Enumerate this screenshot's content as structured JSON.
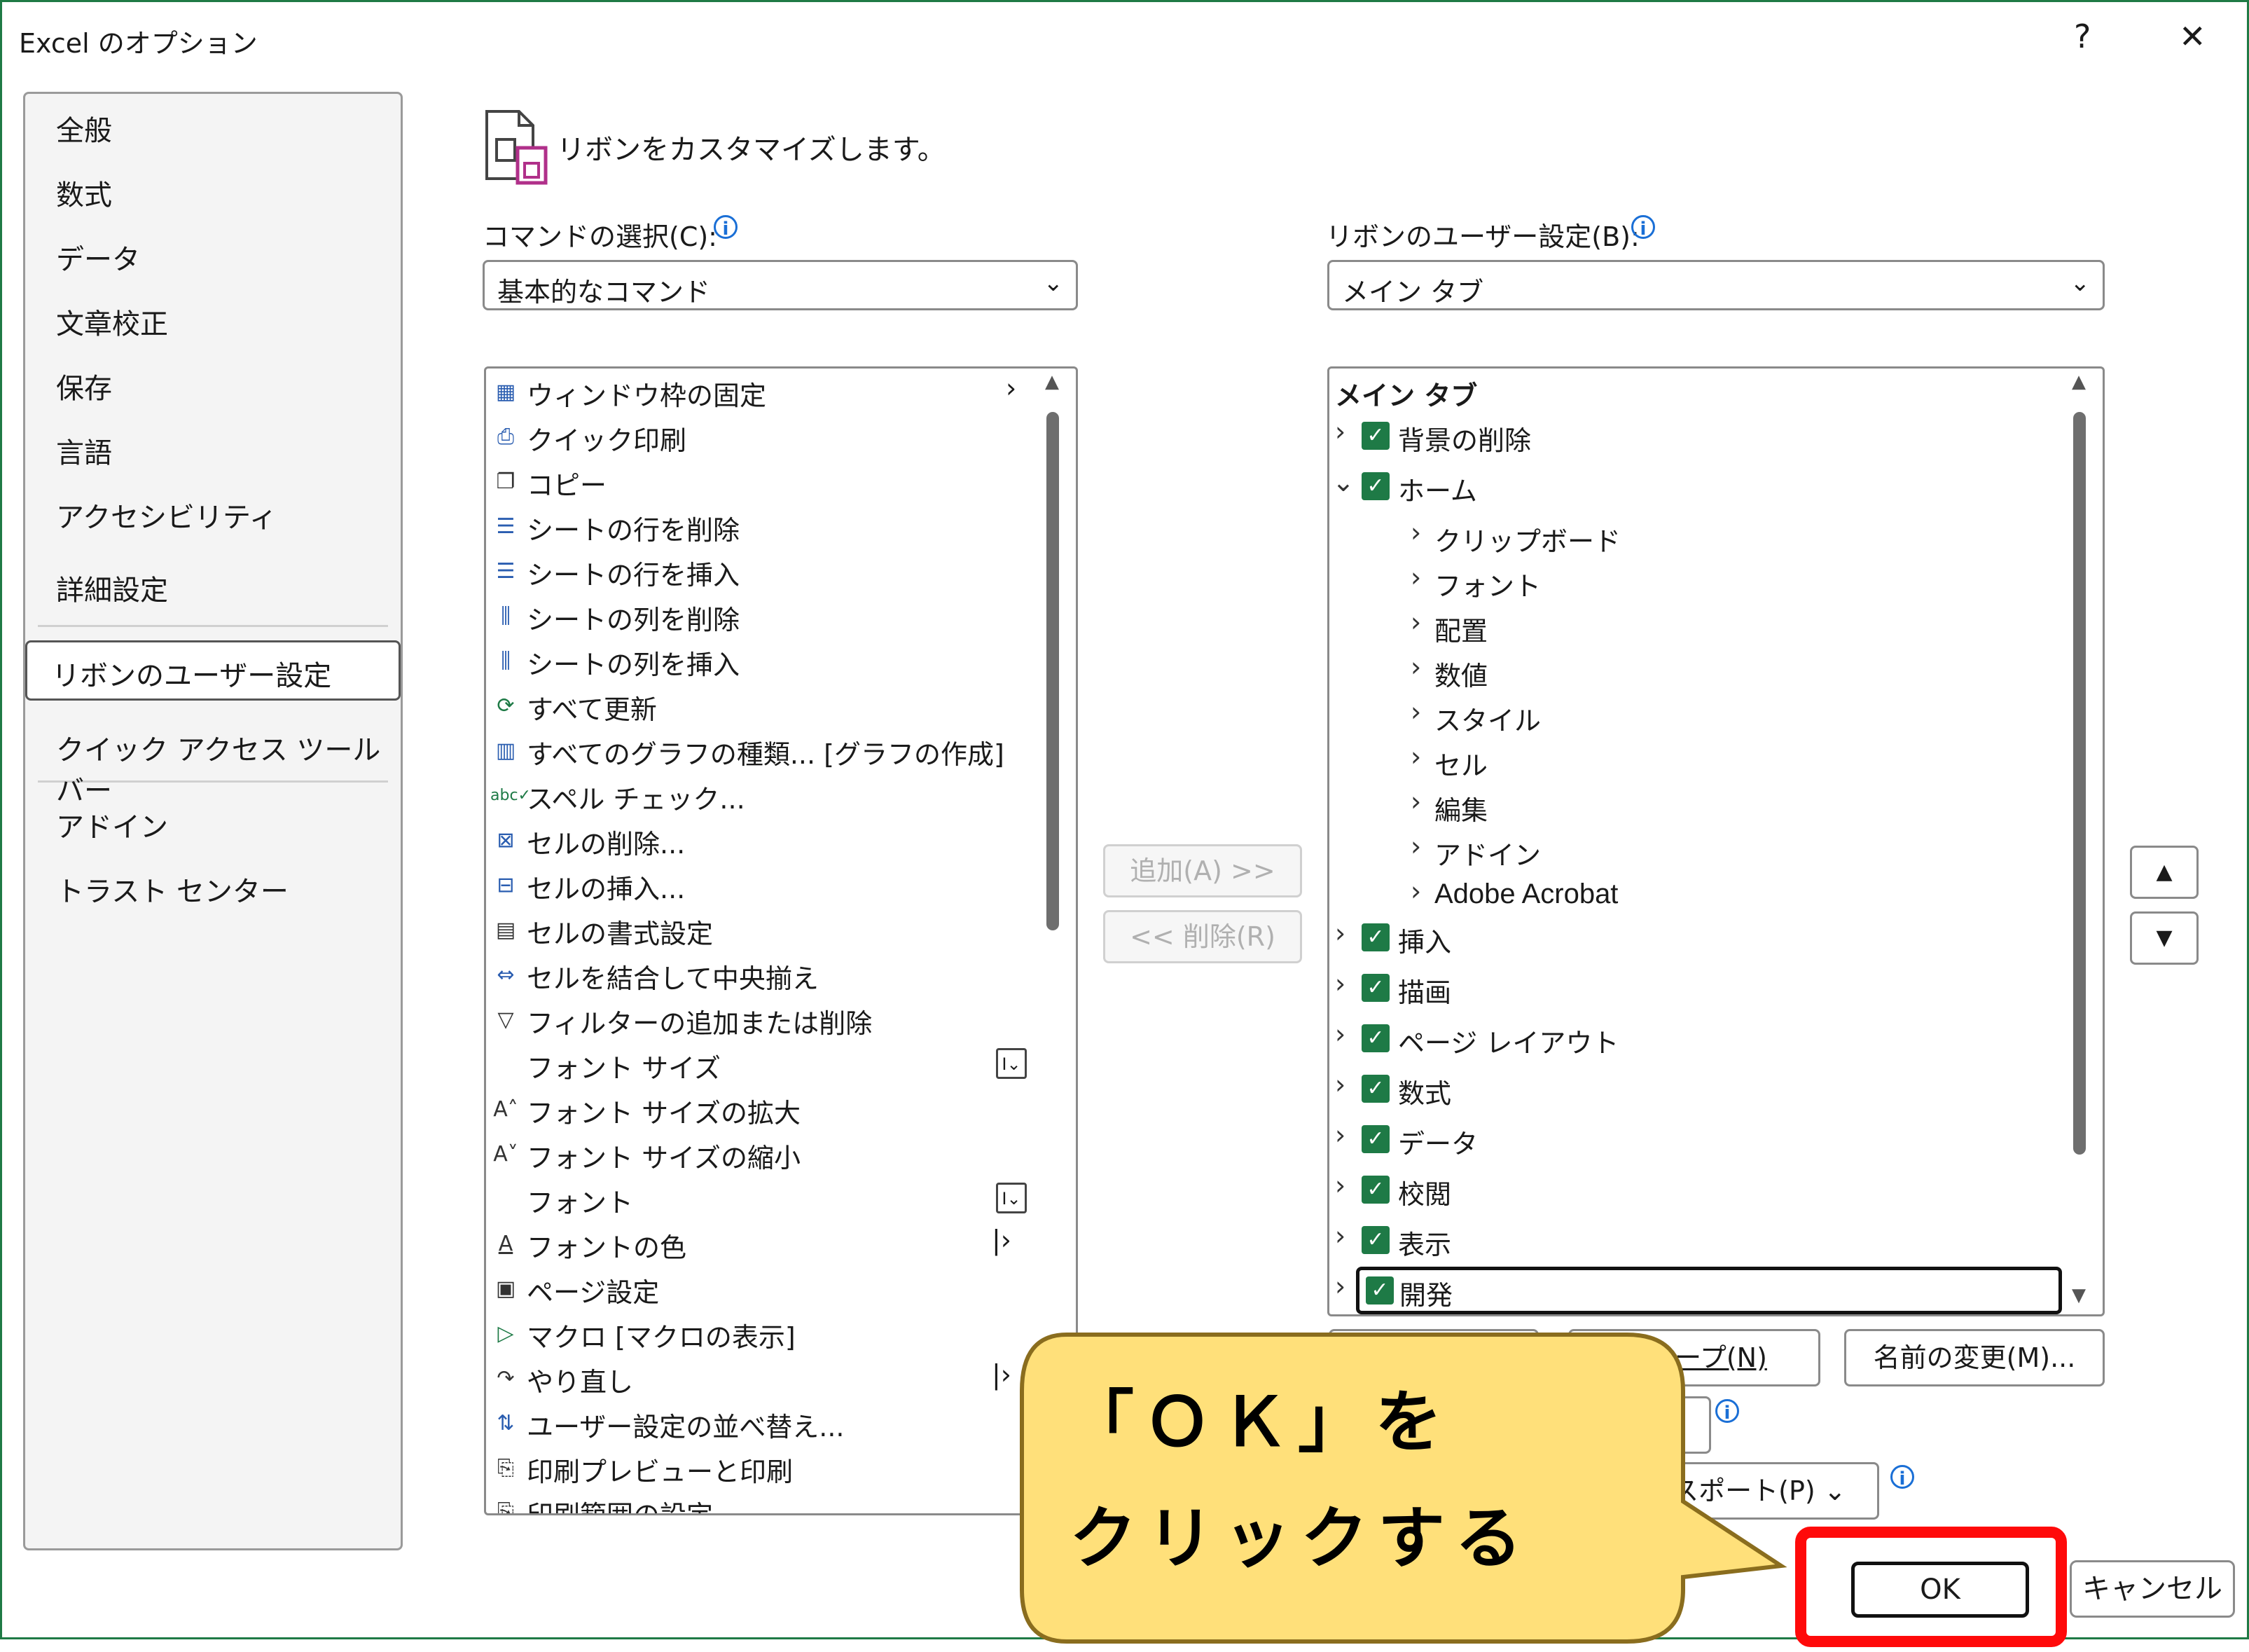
{
  "window": {
    "title": "Excel のオプション",
    "help": "?",
    "close": "✕"
  },
  "nav": {
    "items": [
      "全般",
      "数式",
      "データ",
      "文章校正",
      "保存",
      "言語",
      "アクセシビリティ",
      "詳細設定",
      "リボンのユーザー設定",
      "クイック アクセス ツール バー",
      "アドイン",
      "トラスト センター"
    ],
    "selected": "リボンのユーザー設定"
  },
  "header": {
    "text": "リボンをカスタマイズします。"
  },
  "commands": {
    "label": "コマンドの選択(C):",
    "selected": "基本的なコマンド",
    "items": [
      {
        "text": "ウィンドウ枠の固定",
        "icon": "freeze-panes-icon"
      },
      {
        "text": "クイック印刷",
        "icon": "quick-print-icon"
      },
      {
        "text": "コピー",
        "icon": "copy-icon"
      },
      {
        "text": "シートの行を削除",
        "icon": "delete-row-icon"
      },
      {
        "text": "シートの行を挿入",
        "icon": "insert-row-icon"
      },
      {
        "text": "シートの列を削除",
        "icon": "delete-column-icon"
      },
      {
        "text": "シートの列を挿入",
        "icon": "insert-column-icon"
      },
      {
        "text": "すべて更新",
        "icon": "refresh-all-icon"
      },
      {
        "text": "すべてのグラフの種類... [グラフの作成]",
        "icon": "chart-icon"
      },
      {
        "text": "スペル チェック...",
        "icon": "spell-check-icon"
      },
      {
        "text": "セルの削除...",
        "icon": "delete-cells-icon"
      },
      {
        "text": "セルの挿入...",
        "icon": "insert-cells-icon"
      },
      {
        "text": "セルの書式設定",
        "icon": "format-cells-icon"
      },
      {
        "text": "セルを結合して中央揃え",
        "icon": "merge-center-icon"
      },
      {
        "text": "フィルターの追加または削除",
        "icon": "filter-icon"
      },
      {
        "text": "フォント サイズ",
        "icon": ""
      },
      {
        "text": "フォント サイズの拡大",
        "icon": "font-grow-icon"
      },
      {
        "text": "フォント サイズの縮小",
        "icon": "font-shrink-icon"
      },
      {
        "text": "フォント",
        "icon": ""
      },
      {
        "text": "フォントの色",
        "icon": "font-color-icon"
      },
      {
        "text": "ページ設定",
        "icon": "page-setup-icon"
      },
      {
        "text": "マクロ [マクロの表示]",
        "icon": "macro-icon"
      },
      {
        "text": "やり直し",
        "icon": "redo-icon"
      },
      {
        "text": "ユーザー設定の並べ替え...",
        "icon": "sort-icon"
      },
      {
        "text": "印刷プレビューと印刷",
        "icon": "print-preview-icon"
      },
      {
        "text": "印刷範囲の設定",
        "icon": "print-area-icon"
      }
    ]
  },
  "ribbon": {
    "label": "リボンのユーザー設定(B):",
    "selected": "メイン タブ",
    "root": "メイン タブ",
    "tabs_top": [
      {
        "text": "背景の削除",
        "expanded": false
      },
      {
        "text": "ホーム",
        "expanded": true
      }
    ],
    "groups": [
      "クリップボード",
      "フォント",
      "配置",
      "数値",
      "スタイル",
      "セル",
      "編集",
      "アドイン",
      "Adobe Acrobat"
    ],
    "tabs_bottom": [
      "挿入",
      "描画",
      "ページ レイアウト",
      "数式",
      "データ",
      "校閲",
      "表示",
      "開発"
    ]
  },
  "buttons": {
    "add": "追加(A) >>",
    "remove": "<< 削除(R)",
    "new_group": "グループ(N)",
    "rename": "名前の変更(M)...",
    "import_export": "クスポート(P)",
    "ok": "OK",
    "cancel": "キャンセル",
    "up": "▲",
    "down": "▼"
  },
  "callout": {
    "line1": "「ＯＫ」を",
    "line2": "クリックする",
    "fill": "#ffe07a",
    "stroke": "#8a6d1e"
  },
  "colors": {
    "checkbox": "#1e7a46",
    "highlight": "#ff0a0a",
    "frame": "#1f7a45"
  }
}
